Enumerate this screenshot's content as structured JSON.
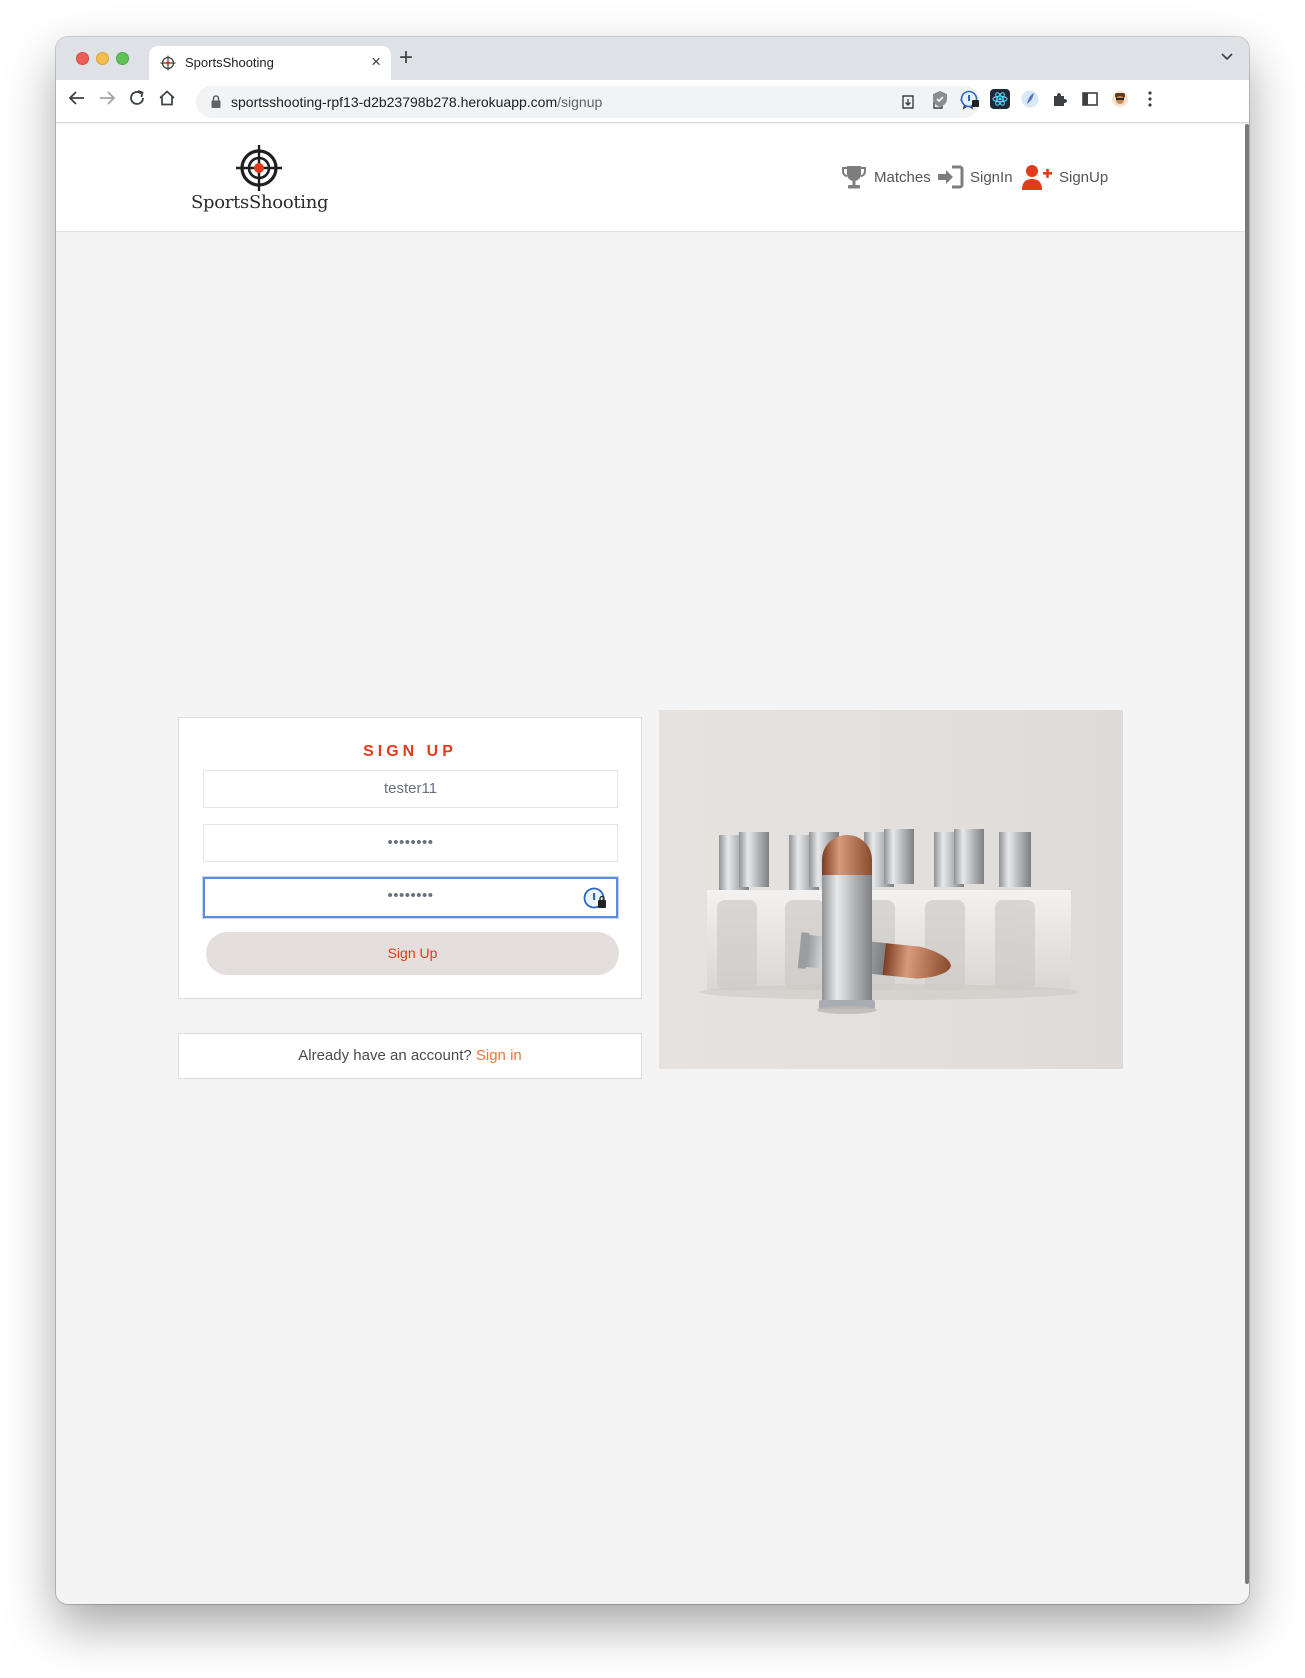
{
  "browser": {
    "tab_title": "SportsShooting",
    "url_host": "sportsshooting-rpf13-d2b23798b278.herokuapp.com",
    "url_path": "/signup"
  },
  "header": {
    "logo_text": "SportsShooting",
    "nav": [
      {
        "label": "Matches",
        "icon": "trophy-icon"
      },
      {
        "label": "SignIn",
        "icon": "sign-in-icon"
      },
      {
        "label": "SignUp",
        "icon": "user-plus-icon"
      }
    ]
  },
  "signup": {
    "title": "SIGN UP",
    "username_value": "tester11",
    "password_value": "••••••••",
    "password_confirm_value": "••••••••",
    "button_label": "Sign Up"
  },
  "signin_prompt": {
    "text": "Already have an account?",
    "link_label": "Sign in"
  },
  "colors": {
    "accent": "#e23a1a",
    "link": "#e8773b",
    "button_bg": "#e4dfdc"
  }
}
